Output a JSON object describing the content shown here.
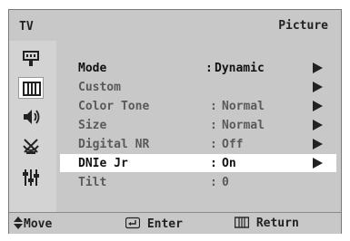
{
  "header": {
    "source_label": "TV",
    "title": "Picture"
  },
  "sidebar": {
    "icons": [
      {
        "name": "input-plug-icon"
      },
      {
        "name": "picture-icon",
        "selected": true
      },
      {
        "name": "sound-speaker-icon"
      },
      {
        "name": "antenna-channel-icon"
      },
      {
        "name": "setup-sliders-icon"
      }
    ]
  },
  "menu": {
    "rows": [
      {
        "label": "Mode",
        "value": "Dynamic",
        "colon": ":",
        "has_arrow": true
      },
      {
        "label": "Custom",
        "value": "",
        "colon": "",
        "has_arrow": true
      },
      {
        "label": "Color Tone",
        "value": "Normal",
        "colon": ":",
        "has_arrow": true
      },
      {
        "label": "Size",
        "value": "Normal",
        "colon": ":",
        "has_arrow": true
      },
      {
        "label": "Digital NR",
        "value": "Off",
        "colon": ":",
        "has_arrow": true
      },
      {
        "label": "DNIe Jr",
        "value": "On",
        "colon": ":",
        "has_arrow": true,
        "selected": true
      },
      {
        "label": "Tilt",
        "value": "0",
        "colon": ":",
        "has_arrow": false
      }
    ]
  },
  "footer": {
    "move_label": "Move",
    "enter_label": "Enter",
    "return_label": "Return"
  },
  "colors": {
    "panel": "#c8c8c8",
    "selected_row": "#ffffff",
    "text": "#222222"
  }
}
